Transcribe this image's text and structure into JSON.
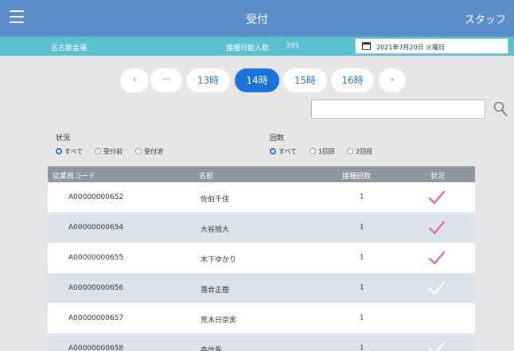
{
  "header": {
    "title": "受付",
    "staff_label": "スタッフ",
    "menu_icon": "hamburger-icon"
  },
  "subheader": {
    "venue": "名古屋会場",
    "capacity_label": "接種可能人数",
    "capacity_value": "395",
    "date": "2021年7月20日 火曜日",
    "date_icon": "calendar-icon"
  },
  "pager": {
    "prev": "‹",
    "ellipsis": "···",
    "hours": [
      "13時",
      "14時",
      "15時",
      "16時"
    ],
    "active_index": 1,
    "next": "›"
  },
  "search": {
    "placeholder": "",
    "icon": "search-icon"
  },
  "filters": {
    "status": {
      "label": "状況",
      "options": [
        "すべて",
        "受付前",
        "受付済"
      ],
      "selected": 0
    },
    "times": {
      "label": "回数",
      "options": [
        "すべて",
        "1回目",
        "2回目"
      ],
      "selected": 0
    }
  },
  "table": {
    "headers": {
      "code": "従業員コード",
      "name": "名前",
      "count": "接種回数",
      "status": "状況"
    },
    "rows": [
      {
        "code": "A00000000652",
        "name": "佐伯千佳",
        "count": "1",
        "checked": true
      },
      {
        "code": "A00000000654",
        "name": "大谷旭大",
        "count": "1",
        "checked": true
      },
      {
        "code": "A00000000655",
        "name": "木下ゆかり",
        "count": "1",
        "checked": true
      },
      {
        "code": "A00000000656",
        "name": "落合正樹",
        "count": "1",
        "checked": false
      },
      {
        "code": "A00000000657",
        "name": "荒木日奈実",
        "count": "1",
        "checked": false
      },
      {
        "code": "A00000000658",
        "name": "森信吾",
        "count": "1",
        "checked": false
      }
    ]
  },
  "colors": {
    "header_bg": "#5b8ec9",
    "subheader_bg": "#5bc0cf",
    "accent": "#1a73d9",
    "check_on": "#e65fa8",
    "check_off": "#ffffff"
  }
}
